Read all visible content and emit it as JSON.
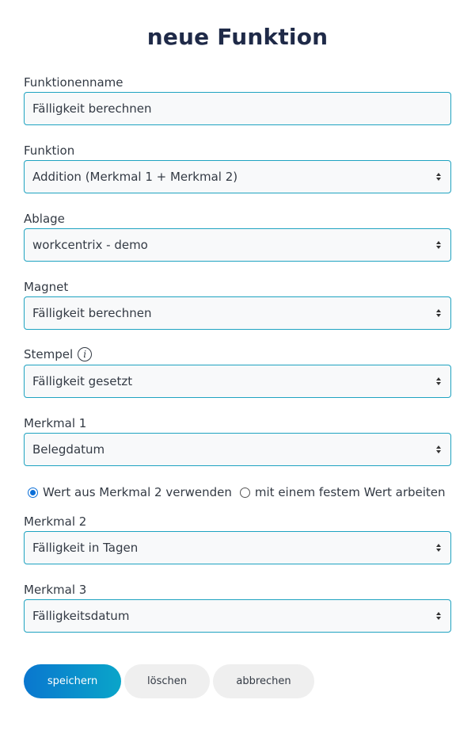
{
  "header": {
    "title": "neue Funktion"
  },
  "form": {
    "name": {
      "label": "Funktionenname",
      "value": "Fälligkeit berechnen"
    },
    "function": {
      "label": "Funktion",
      "value": "Addition (Merkmal 1 + Merkmal 2)"
    },
    "storage": {
      "label": "Ablage",
      "value": "workcentrix - demo"
    },
    "magnet": {
      "label": "Magnet",
      "value": "Fälligkeit berechnen"
    },
    "stamp": {
      "label": "Stempel",
      "value": "Fälligkeit gesetzt",
      "info_icon": "i"
    },
    "feature1": {
      "label": "Merkmal 1",
      "value": "Belegdatum"
    },
    "mode": {
      "option_value": "Wert aus Merkmal 2 verwenden",
      "option_fixed": "mit einem festem Wert arbeiten",
      "selected": "option_value"
    },
    "feature2": {
      "label": "Merkmal 2",
      "value": "Fälligkeit in Tagen"
    },
    "feature3": {
      "label": "Merkmal 3",
      "value": "Fälligkeitsdatum"
    }
  },
  "buttons": {
    "save": "speichern",
    "delete": "löschen",
    "cancel": "abbrechen"
  },
  "colors": {
    "title": "#1f2a48",
    "field_border": "#1fa3c1",
    "field_bg": "#f8f9fa",
    "primary_gradient_start": "#0a77cf",
    "primary_gradient_end": "#0aa5c9",
    "radio_checked": "#0b6fd8",
    "secondary_button_bg": "#efefef"
  }
}
